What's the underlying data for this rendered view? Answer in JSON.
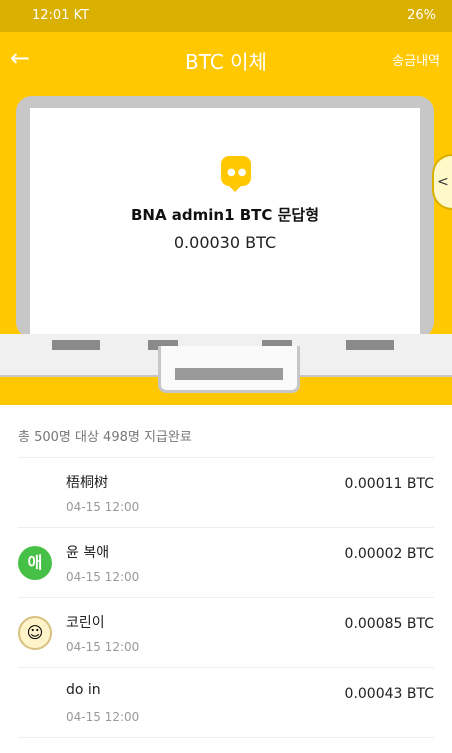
{
  "status": {
    "time": "12:01 KT",
    "right": "26%"
  },
  "appbar": {
    "title": "BTC 이체",
    "history": "송금내역"
  },
  "card": {
    "title": "BNA admin1  BTC  문답형",
    "amount": "0.00030  BTC"
  },
  "summary": "총 500명 대상 498명 지급완료",
  "list": [
    {
      "name": "梧桐树",
      "time": "04-15 12:00",
      "amount": "0.00011 BTC"
    },
    {
      "avatar": "애",
      "name": "윤 복애",
      "time": "04-15 12:00",
      "amount": "0.00002 BTC"
    },
    {
      "name": "코린이",
      "time": "04-15 12:00",
      "amount": "0.00085 BTC"
    },
    {
      "name": "do in",
      "time": "04-15 12:00",
      "amount": "0.00043 BTC"
    }
  ]
}
